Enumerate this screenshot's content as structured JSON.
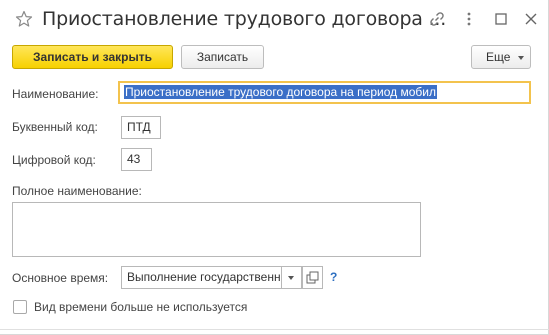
{
  "window": {
    "title": "Приостановление трудового договора ...",
    "icons": [
      "star-icon",
      "link-icon",
      "more-vertical-icon",
      "maximize-icon",
      "close-icon"
    ]
  },
  "toolbar": {
    "save_close_label": "Записать и закрыть",
    "save_label": "Записать",
    "more_label": "Еще"
  },
  "form": {
    "name_label": "Наименование:",
    "name_value": "Приостановление трудового договора на период мобил",
    "letter_code_label": "Буквенный код:",
    "letter_code_value": "ПТД",
    "digit_code_label": "Цифровой код:",
    "digit_code_value": "43",
    "full_name_label": "Полное наименование:",
    "full_name_value": "",
    "main_time_label": "Основное время:",
    "main_time_value": "Выполнение государственн",
    "help_label": "?",
    "unused_label": "Вид времени больше не используется",
    "unused_checked": false
  },
  "colors": {
    "primary_button": "#f7d100",
    "selection": "#3b6fc7",
    "focus_border": "#f3c34d",
    "help": "#2d6fc0"
  }
}
